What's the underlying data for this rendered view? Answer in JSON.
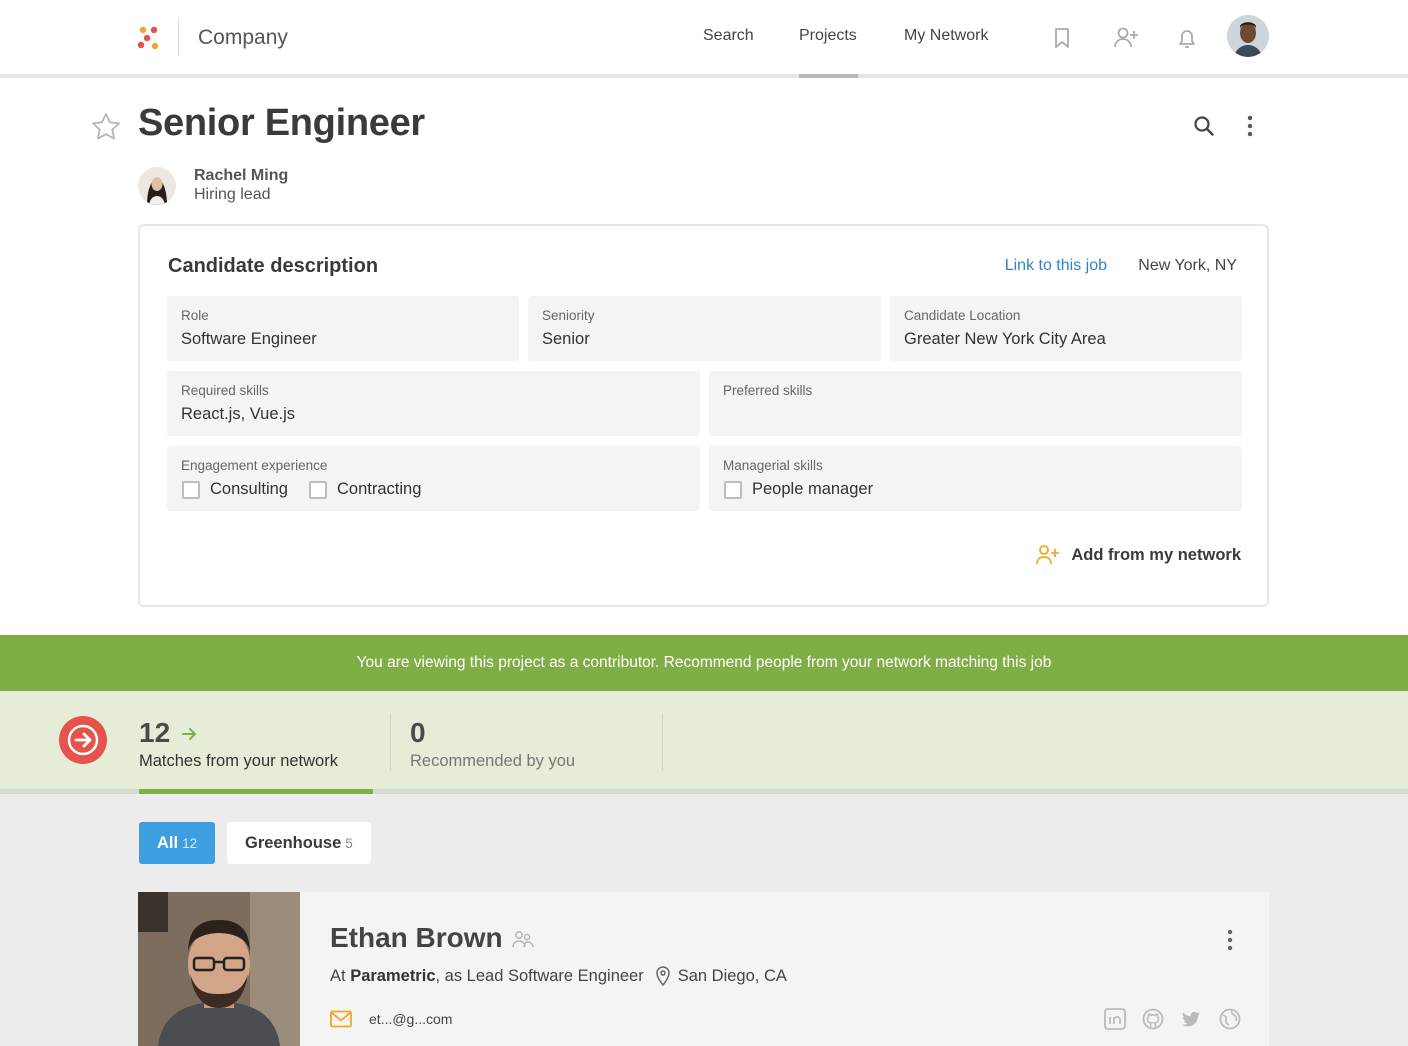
{
  "header": {
    "company": "Company",
    "nav": [
      "Search",
      "Projects",
      "My Network"
    ],
    "active_nav": "Projects"
  },
  "project": {
    "title": "Senior Engineer",
    "lead_name": "Rachel Ming",
    "lead_role": "Hiring lead"
  },
  "card": {
    "title": "Candidate description",
    "link_label": "Link to this job",
    "location": "New York, NY",
    "role_label": "Role",
    "role_value": "Software Engineer",
    "seniority_label": "Seniority",
    "seniority_value": "Senior",
    "cand_loc_label": "Candidate Location",
    "cand_loc_value": "Greater New York City Area",
    "required_label": "Required skills",
    "required_value": "React.js, Vue.js",
    "preferred_label": "Preferred skills",
    "preferred_value": "",
    "engagement_label": "Engagement experience",
    "engagement_options": [
      "Consulting",
      "Contracting"
    ],
    "managerial_label": "Managerial skills",
    "managerial_options": [
      "People manager"
    ],
    "add_network_label": "Add from my network"
  },
  "banner": "You are viewing this project as a contributor. Recommend people from your network matching this job",
  "stats": {
    "matches_count": "12",
    "matches_label": "Matches from your network",
    "recommended_count": "0",
    "recommended_label": "Recommended by you"
  },
  "filters": {
    "all_label": "All",
    "all_count": "12",
    "greenhouse_label": "Greenhouse",
    "greenhouse_count": "5"
  },
  "person": {
    "name": "Ethan Brown",
    "at": "At",
    "company": "Parametric",
    "as_title": ", as Lead Software Engineer",
    "location": "San Diego, CA",
    "email": "et...@g...com"
  },
  "colors": {
    "accent_green": "#7fae47",
    "accent_blue": "#3d9ee0",
    "link_blue": "#2f84c6",
    "action_red": "#e5534b",
    "orange_icon": "#f5a623"
  }
}
